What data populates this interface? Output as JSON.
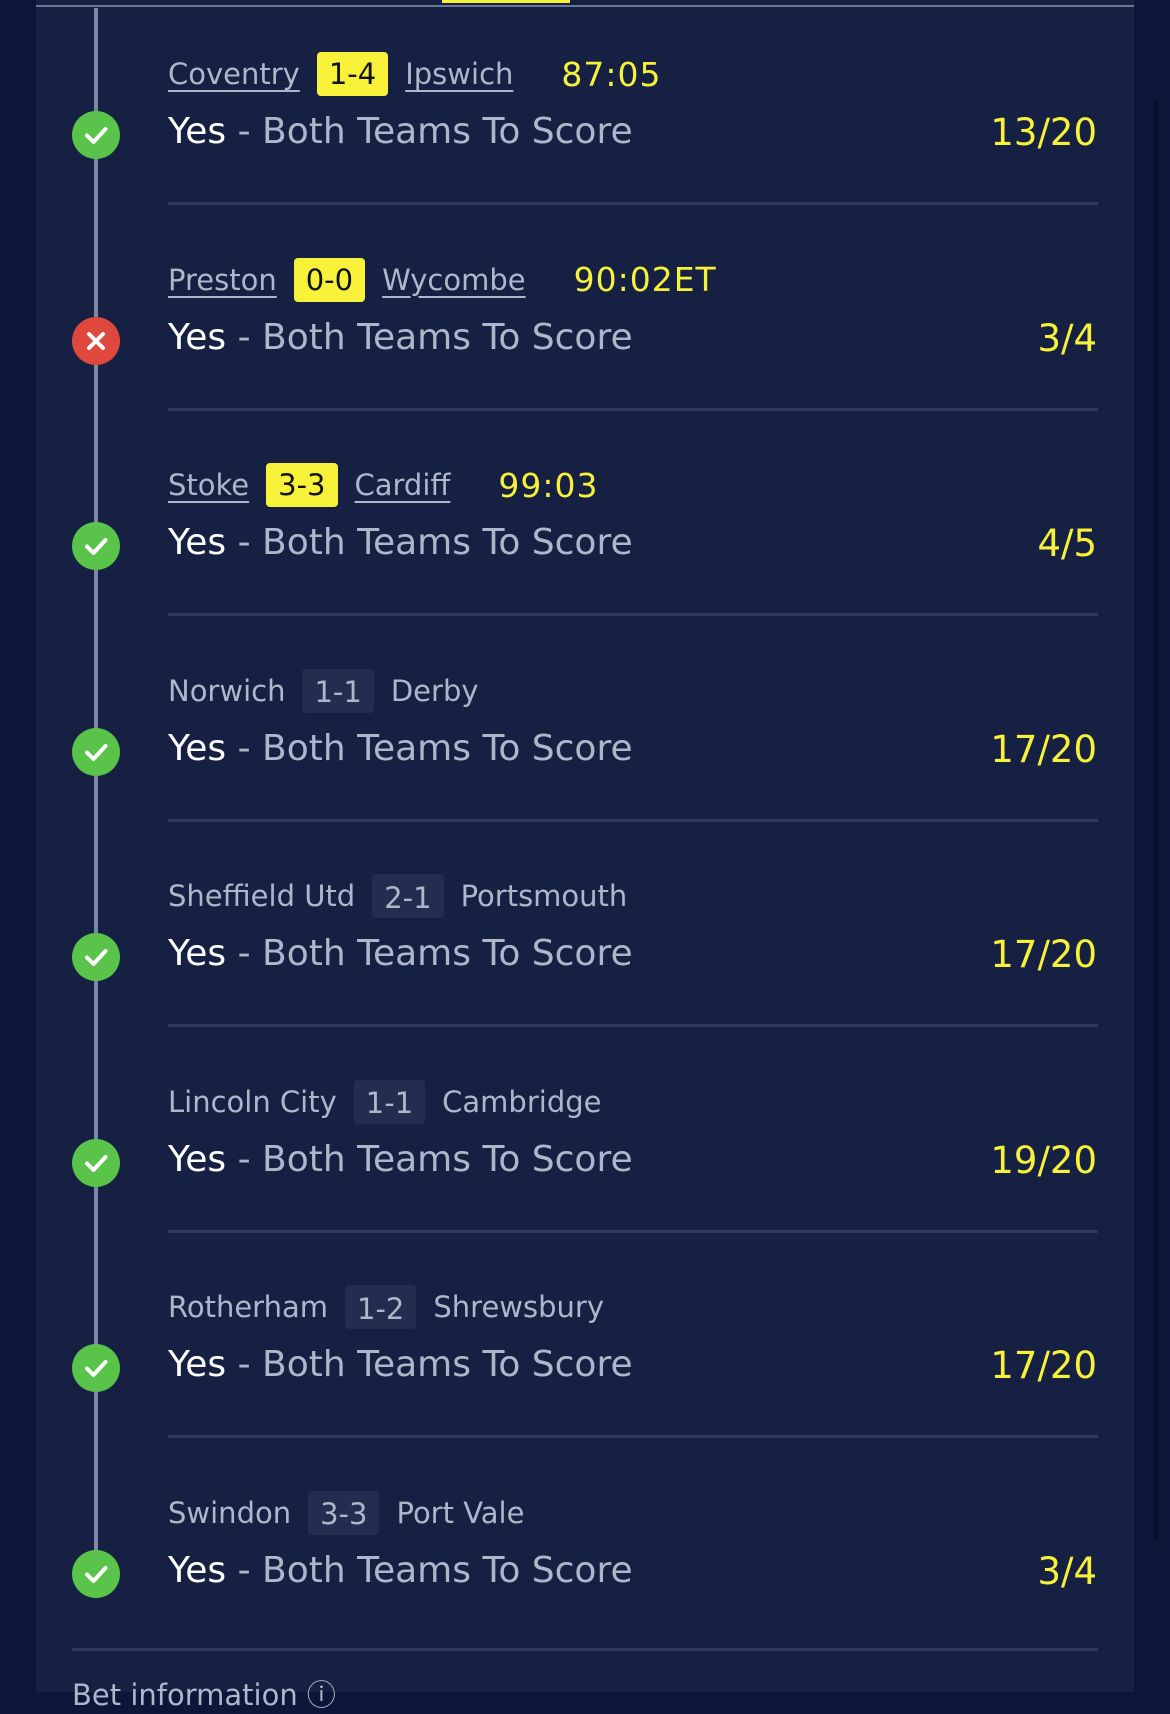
{
  "colors": {
    "background": "#0b1638",
    "panel": "#152043",
    "accent_yellow": "#f7f13a",
    "won_green": "#5ac34a",
    "lost_red": "#e0483d",
    "muted_text": "#aeb6c9"
  },
  "selections": [
    {
      "home": "Coventry",
      "score": "1-4",
      "away": "Ipswich",
      "clock": "87:05",
      "live": true,
      "status": "won",
      "status_icon": "check-icon",
      "pick": "Yes",
      "market": " - Both Teams To Score",
      "odds": "13/20"
    },
    {
      "home": "Preston",
      "score": "0-0",
      "away": "Wycombe",
      "clock": "90:02ET",
      "live": true,
      "status": "lost",
      "status_icon": "cross-icon",
      "pick": "Yes",
      "market": " - Both Teams To Score",
      "odds": "3/4"
    },
    {
      "home": "Stoke",
      "score": "3-3",
      "away": "Cardiff",
      "clock": "99:03",
      "live": true,
      "status": "won",
      "status_icon": "check-icon",
      "pick": "Yes",
      "market": " - Both Teams To Score",
      "odds": "4/5"
    },
    {
      "home": "Norwich",
      "score": "1-1",
      "away": "Derby",
      "clock": "",
      "live": false,
      "status": "won",
      "status_icon": "check-icon",
      "pick": "Yes",
      "market": " - Both Teams To Score",
      "odds": "17/20"
    },
    {
      "home": "Sheffield Utd",
      "score": "2-1",
      "away": "Portsmouth",
      "clock": "",
      "live": false,
      "status": "won",
      "status_icon": "check-icon",
      "pick": "Yes",
      "market": " - Both Teams To Score",
      "odds": "17/20"
    },
    {
      "home": "Lincoln City",
      "score": "1-1",
      "away": "Cambridge",
      "clock": "",
      "live": false,
      "status": "won",
      "status_icon": "check-icon",
      "pick": "Yes",
      "market": " - Both Teams To Score",
      "odds": "19/20"
    },
    {
      "home": "Rotherham",
      "score": "1-2",
      "away": "Shrewsbury",
      "clock": "",
      "live": false,
      "status": "won",
      "status_icon": "check-icon",
      "pick": "Yes",
      "market": " - Both Teams To Score",
      "odds": "17/20"
    },
    {
      "home": "Swindon",
      "score": "3-3",
      "away": "Port Vale",
      "clock": "",
      "live": false,
      "status": "won",
      "status_icon": "check-icon",
      "pick": "Yes",
      "market": " - Both Teams To Score",
      "odds": "3/4"
    }
  ],
  "footer": {
    "label": "Bet information ⓘ"
  }
}
